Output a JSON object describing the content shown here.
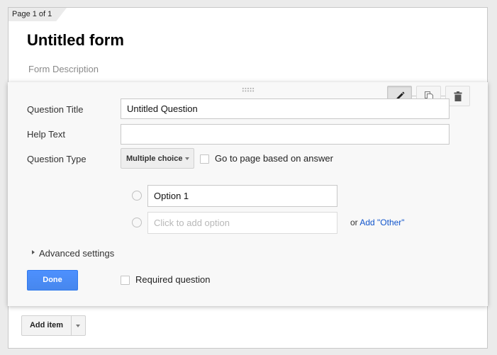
{
  "page": {
    "tab_label": "Page 1 of 1"
  },
  "form": {
    "title": "Untitled form",
    "description_placeholder": "Form Description"
  },
  "question_editor": {
    "toolbar": {
      "edit_icon": "pencil-icon",
      "duplicate_icon": "duplicate-icon",
      "delete_icon": "trash-icon"
    },
    "fields": {
      "title_label": "Question Title",
      "title_value": "Untitled Question",
      "help_label": "Help Text",
      "help_value": "",
      "type_label": "Question Type",
      "type_selected": "Multiple choice"
    },
    "go_to_page_label": "Go to page based on answer",
    "go_to_page_checked": false,
    "options": [
      {
        "value": "Option 1"
      }
    ],
    "add_option_placeholder": "Click to add option",
    "or_text": "or",
    "add_other_link": "Add \"Other\"",
    "advanced_settings_label": "Advanced settings",
    "done_label": "Done",
    "required_label": "Required question",
    "required_checked": false
  },
  "footer": {
    "add_item_label": "Add item"
  },
  "colors": {
    "primary_button": "#4d90fe",
    "link": "#1155cc"
  }
}
